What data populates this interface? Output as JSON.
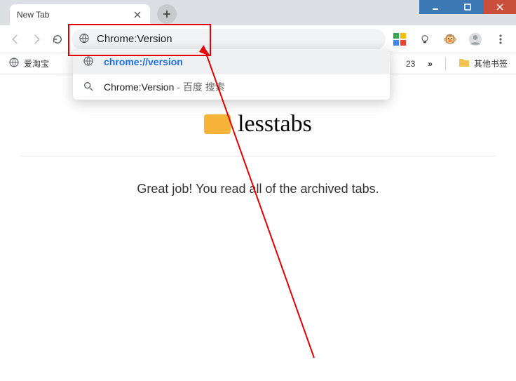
{
  "tab": {
    "title": "New Tab"
  },
  "omnibox": {
    "value": "Chrome:Version"
  },
  "suggestions": [
    {
      "kind": "url",
      "text": "chrome://version"
    },
    {
      "kind": "search",
      "text": "Chrome:Version",
      "suffix": " - 百度 搜索"
    }
  ],
  "bookmarks": {
    "first": "爱淘宝",
    "truncated_number": "23",
    "other": "其他书签"
  },
  "page": {
    "brand": "lesstabs",
    "message": "Great job! You read all of the archived tabs."
  }
}
